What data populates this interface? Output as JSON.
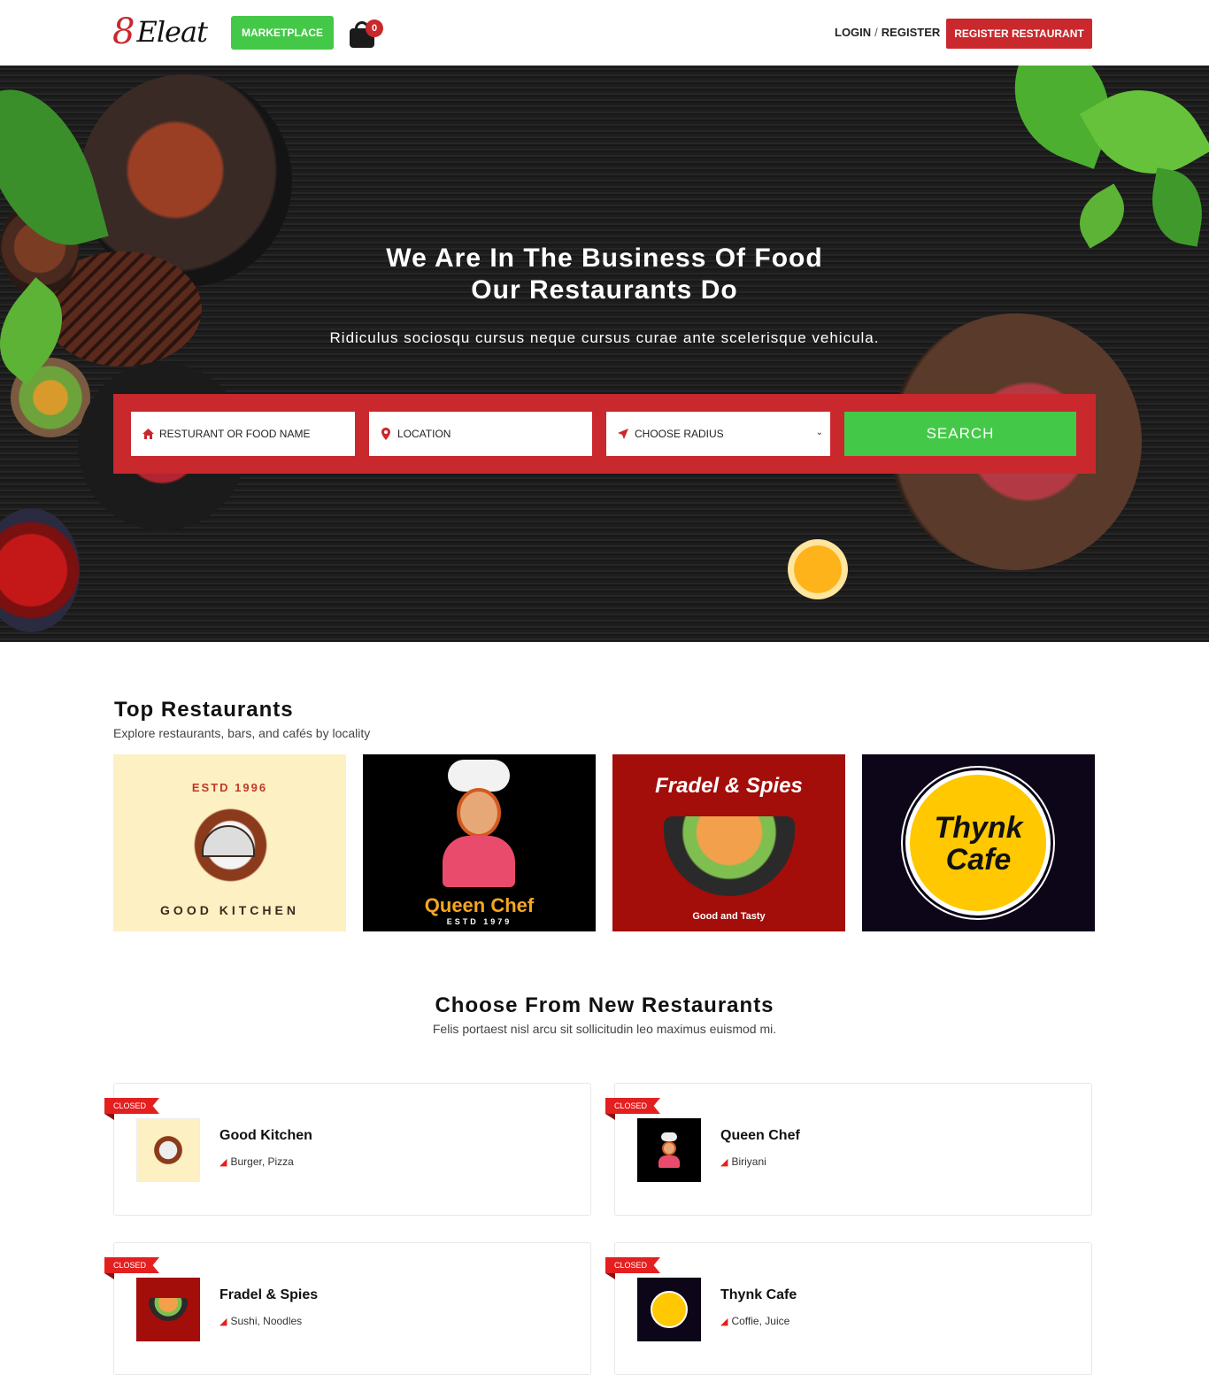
{
  "header": {
    "logo_mark": "8",
    "logo_word": "Eleat",
    "marketplace_label": "MARKETPLACE",
    "cart_count": "0",
    "login_label": "LOGIN",
    "login_sep": "/",
    "register_label": "REGISTER",
    "register_restaurant_label": "REGISTER RESTAURANT"
  },
  "hero": {
    "title_line1": "We Are In The Business Of Food",
    "title_line2": "Our Restaurants Do",
    "subtitle": "Ridiculus sociosqu cursus neque cursus curae ante scelerisque vehicula.",
    "search": {
      "name_placeholder": "RESTURANT OR FOOD NAME",
      "location_placeholder": "LOCATION",
      "radius_placeholder": "CHOOSE RADIUS",
      "button_label": "SEARCH"
    }
  },
  "top_restaurants": {
    "title": "Top Restaurants",
    "subtitle": "Explore restaurants, bars, and cafés by locality",
    "cards": [
      {
        "line1": "ESTD 1996",
        "line2": "GOOD KITCHEN",
        "bg": "#fdf0c2"
      },
      {
        "line1": "Queen Chef",
        "line2": "ESTD 1979",
        "bg": "#000000"
      },
      {
        "line1": "Fradel & Spies",
        "line2": "Good and Tasty",
        "bg": "#a30d0a"
      },
      {
        "line1": "Thynk",
        "line2": "Cafe",
        "bg": "#0d0618"
      }
    ]
  },
  "new_restaurants": {
    "title": "Choose From New Restaurants",
    "subtitle": "Felis portaest nisl arcu sit sollicitudin leo maximus euismod mi.",
    "items": [
      {
        "status": "CLOSED",
        "name": "Good Kitchen",
        "tags": "Burger, Pizza"
      },
      {
        "status": "CLOSED",
        "name": "Queen Chef",
        "tags": "Biriyani"
      },
      {
        "status": "CLOSED",
        "name": "Fradel & Spies",
        "tags": "Sushi, Noodles"
      },
      {
        "status": "CLOSED",
        "name": "Thynk Cafe",
        "tags": "Coffie, Juice"
      }
    ]
  },
  "colors": {
    "brand_red": "#c9282d",
    "accent_green": "#44c848",
    "ribbon_red": "#e41f1f"
  }
}
